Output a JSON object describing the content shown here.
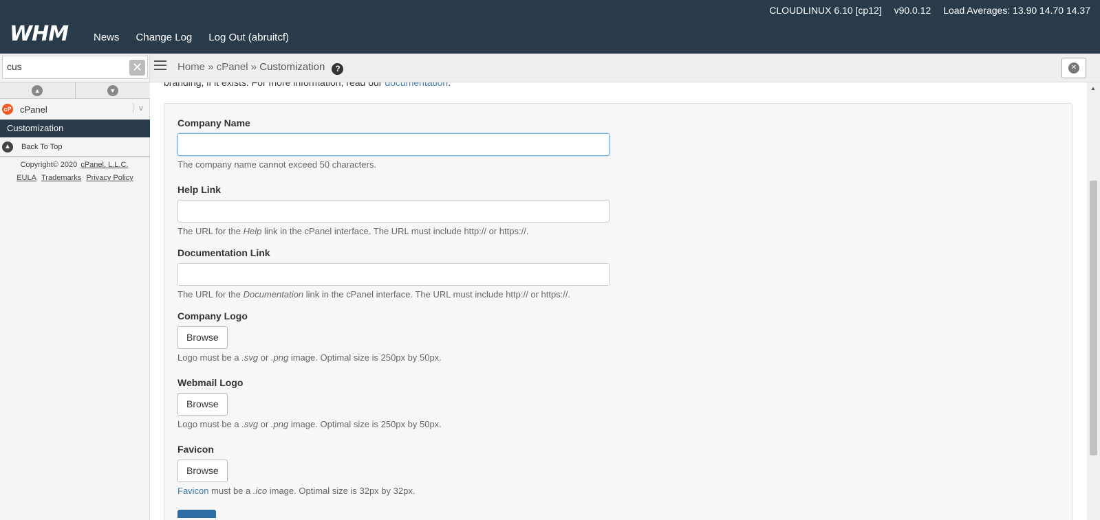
{
  "header": {
    "logo": "WHM",
    "nav": [
      "News",
      "Change Log",
      "Log Out (abruitcf)"
    ],
    "system": "CLOUDLINUX 6.10 [cp12]",
    "version": "v90.0.12",
    "load": "Load Averages: 13.90 14.70 14.37"
  },
  "sidebar": {
    "search_value": "cus",
    "category": "cPanel",
    "active_item": "Customization",
    "back_to_top": "Back To Top",
    "copyright": "Copyright© 2020",
    "copyright_link": "cPanel, L.L.C.",
    "footer_links": [
      "EULA",
      "Trademarks",
      "Privacy Policy"
    ]
  },
  "breadcrumb": {
    "home": "Home",
    "sep": "»",
    "parent": "cPanel",
    "current": "Customization"
  },
  "main": {
    "intro_text": "branding, if it exists. For more information, read our",
    "intro_link": "documentation",
    "intro_end": ".",
    "company_name": {
      "label": "Company Name",
      "value": "",
      "help": "The company name cannot exceed 50 characters."
    },
    "help_link": {
      "label": "Help Link",
      "value": "",
      "help_pre": "The URL for the",
      "help_em": "Help",
      "help_post": "link in the cPanel interface. The URL must include http:// or https://."
    },
    "doc_link": {
      "label": "Documentation Link",
      "value": "",
      "help_pre": "The URL for the",
      "help_em": "Documentation",
      "help_post": "link in the cPanel interface. The URL must include http:// or https://."
    },
    "company_logo": {
      "label": "Company Logo",
      "button": "Browse",
      "help_pre": "Logo must be a",
      "ext1": ".svg",
      "or": "or",
      "ext2": ".png",
      "help_post": "image. Optimal size is 250px by 50px."
    },
    "webmail_logo": {
      "label": "Webmail Logo",
      "button": "Browse",
      "help_pre": "Logo must be a",
      "ext1": ".svg",
      "or": "or",
      "ext2": ".png",
      "help_post": "image. Optimal size is 250px by 50px."
    },
    "favicon": {
      "label": "Favicon",
      "button": "Browse",
      "help_link": "Favicon",
      "help_pre": "must be a",
      "ext": ".ico",
      "help_post": "image. Optimal size is 32px by 32px."
    }
  }
}
